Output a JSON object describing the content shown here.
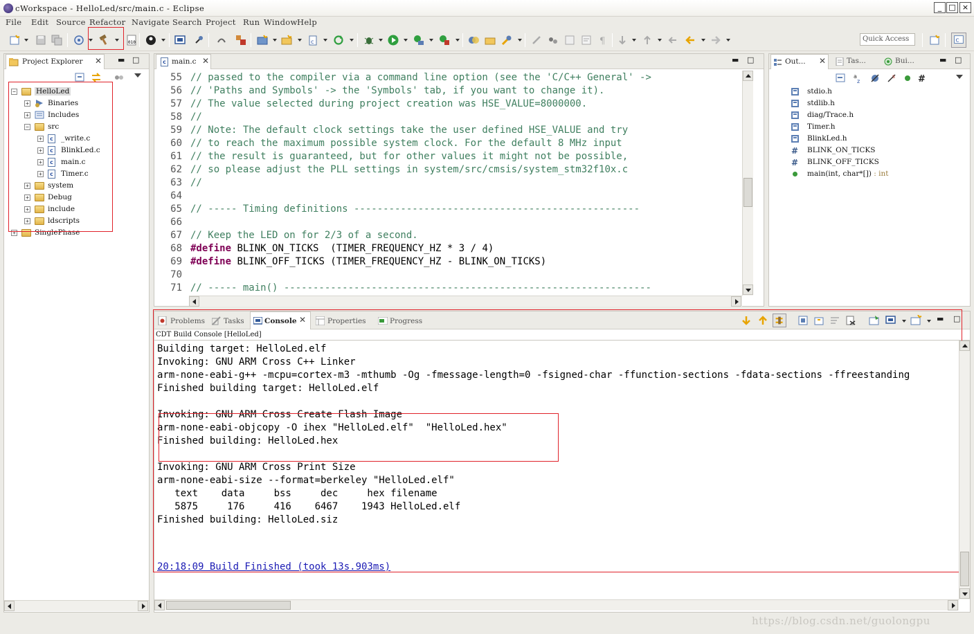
{
  "window": {
    "title": "cWorkspace - HelloLed/src/main.c - Eclipse",
    "min": "_",
    "max": "□",
    "close": "×"
  },
  "menu": [
    "File",
    "Edit",
    "Source",
    "Refactor",
    "Navigate",
    "Search",
    "Project",
    "Run",
    "Window",
    "Help"
  ],
  "toolbar": {
    "quick_access_placeholder": "Quick Access"
  },
  "project_explorer": {
    "tab_label": "Project Explorer",
    "items": [
      {
        "label": "HelloLed",
        "kind": "project",
        "level": 0,
        "expanded": true
      },
      {
        "label": "Binaries",
        "kind": "binaries",
        "level": 1
      },
      {
        "label": "Includes",
        "kind": "includes",
        "level": 1
      },
      {
        "label": "src",
        "kind": "folder",
        "level": 1,
        "expanded": true
      },
      {
        "label": "_write.c",
        "kind": "cfile",
        "level": 2
      },
      {
        "label": "BlinkLed.c",
        "kind": "cfile",
        "level": 2
      },
      {
        "label": "main.c",
        "kind": "cfile",
        "level": 2
      },
      {
        "label": "Timer.c",
        "kind": "cfile",
        "level": 2
      },
      {
        "label": "system",
        "kind": "folder",
        "level": 1
      },
      {
        "label": "Debug",
        "kind": "folder",
        "level": 1
      },
      {
        "label": "include",
        "kind": "folder",
        "level": 1
      },
      {
        "label": "ldscripts",
        "kind": "folder",
        "level": 1
      },
      {
        "label": "SinglePhase",
        "kind": "project",
        "level": 0
      }
    ]
  },
  "editor": {
    "tab_label": "main.c",
    "lines": [
      {
        "n": "55",
        "parts": [
          {
            "t": "cm",
            "s": "// passed to the compiler via a command line option (see the 'C/C++ General' ->"
          }
        ]
      },
      {
        "n": "56",
        "parts": [
          {
            "t": "cm",
            "s": "// 'Paths and Symbols' -> the 'Symbols' tab, if you want to change it)."
          }
        ]
      },
      {
        "n": "57",
        "parts": [
          {
            "t": "cm",
            "s": "// The value selected during project creation was HSE_VALUE=8000000."
          }
        ]
      },
      {
        "n": "58",
        "parts": [
          {
            "t": "cm",
            "s": "//"
          }
        ]
      },
      {
        "n": "59",
        "parts": [
          {
            "t": "cm",
            "s": "// Note: The default clock settings take the user defined HSE_VALUE and try"
          }
        ]
      },
      {
        "n": "60",
        "parts": [
          {
            "t": "cm",
            "s": "// to reach the maximum possible system clock. For the default 8 MHz input"
          }
        ]
      },
      {
        "n": "61",
        "parts": [
          {
            "t": "cm",
            "s": "// the result is guaranteed, but for other values it might not be possible,"
          }
        ]
      },
      {
        "n": "62",
        "parts": [
          {
            "t": "cm",
            "s": "// so please adjust the PLL settings in system/src/cmsis/system_stm32f10x.c"
          }
        ]
      },
      {
        "n": "63",
        "parts": [
          {
            "t": "cm",
            "s": "//"
          }
        ]
      },
      {
        "n": "64",
        "parts": [
          {
            "t": "pl",
            "s": ""
          }
        ]
      },
      {
        "n": "65",
        "parts": [
          {
            "t": "cm",
            "s": "// ----- Timing definitions -------------------------------------------------"
          }
        ]
      },
      {
        "n": "66",
        "parts": [
          {
            "t": "pl",
            "s": ""
          }
        ]
      },
      {
        "n": "67",
        "parts": [
          {
            "t": "cm",
            "s": "// Keep the LED on for 2/3 of a second."
          }
        ]
      },
      {
        "n": "68",
        "parts": [
          {
            "t": "kw",
            "s": "#define"
          },
          {
            "t": "pl",
            "s": " BLINK_ON_TICKS  (TIMER_FREQUENCY_HZ * 3 / 4)"
          }
        ]
      },
      {
        "n": "69",
        "parts": [
          {
            "t": "kw",
            "s": "#define"
          },
          {
            "t": "pl",
            "s": " BLINK_OFF_TICKS (TIMER_FREQUENCY_HZ - BLINK_ON_TICKS)"
          }
        ]
      },
      {
        "n": "70",
        "parts": [
          {
            "t": "pl",
            "s": ""
          }
        ]
      },
      {
        "n": "71",
        "parts": [
          {
            "t": "cm",
            "s": "// ----- main() ---------------------------------------------------------------"
          }
        ]
      }
    ]
  },
  "outline": {
    "tabs": [
      "Out...",
      "Tas...",
      "Bui..."
    ],
    "items": [
      {
        "label": "stdio.h",
        "kind": "include"
      },
      {
        "label": "stdlib.h",
        "kind": "include"
      },
      {
        "label": "diag/Trace.h",
        "kind": "include"
      },
      {
        "label": "Timer.h",
        "kind": "include"
      },
      {
        "label": "BlinkLed.h",
        "kind": "include"
      },
      {
        "label": "BLINK_ON_TICKS",
        "kind": "macro"
      },
      {
        "label": "BLINK_OFF_TICKS",
        "kind": "macro"
      },
      {
        "label": "main(int, char*[])",
        "kind": "function",
        "type": " : int"
      }
    ]
  },
  "console": {
    "tabs": [
      "Problems",
      "Tasks",
      "Console",
      "Properties",
      "Progress"
    ],
    "active_tab": "Console",
    "header": "CDT Build Console [HelloLed]",
    "lines": [
      "",
      "Building target: HelloLed.elf",
      "Invoking: GNU ARM Cross C++ Linker",
      "arm-none-eabi-g++ -mcpu=cortex-m3 -mthumb -Og -fmessage-length=0 -fsigned-char -ffunction-sections -fdata-sections -ffreestanding",
      "Finished building target: HelloLed.elf",
      "",
      "Invoking: GNU ARM Cross Create Flash Image",
      "arm-none-eabi-objcopy -O ihex \"HelloLed.elf\"  \"HelloLed.hex\"",
      "Finished building: HelloLed.hex",
      "",
      "Invoking: GNU ARM Cross Print Size",
      "arm-none-eabi-size --format=berkeley \"HelloLed.elf\"",
      "   text    data     bss     dec     hex filename",
      "   5875     176     416    6467    1943 HelloLed.elf",
      "Finished building: HelloLed.siz",
      "",
      ""
    ],
    "finish_line": "20:18:09 Build Finished (took 13s.903ms)"
  },
  "watermark": "https://blog.csdn.net/guolongpu",
  "colors": {
    "comment": "#3f7f5f",
    "keyword": "#7f0055",
    "annotation_red": "#e0222a",
    "build_finished": "#1a1ab4"
  }
}
